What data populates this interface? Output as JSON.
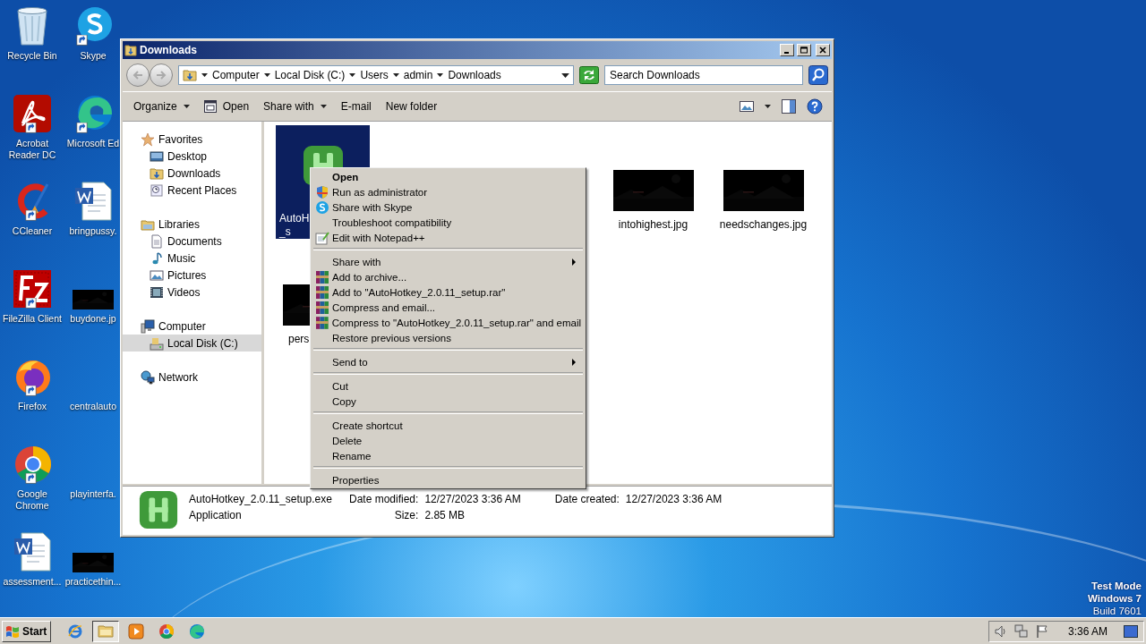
{
  "desktop": {
    "icons_column_1": [
      {
        "label": "Recycle Bin",
        "kind": "recycle",
        "shortcut": false
      },
      {
        "label": "Acrobat Reader DC",
        "kind": "acrobat",
        "shortcut": true
      },
      {
        "label": "CCleaner",
        "kind": "ccleaner",
        "shortcut": true
      },
      {
        "label": "FileZilla Client",
        "kind": "filezilla",
        "shortcut": true
      },
      {
        "label": "Firefox",
        "kind": "firefox",
        "shortcut": true
      },
      {
        "label": "Google Chrome",
        "kind": "chrome",
        "shortcut": true
      },
      {
        "label": "assessment...",
        "kind": "word",
        "shortcut": false
      }
    ],
    "icons_column_2": [
      {
        "label": "Skype",
        "kind": "skype",
        "shortcut": true
      },
      {
        "label": "Microsoft Ed",
        "kind": "edge",
        "shortcut": true
      },
      {
        "label": "bringpussy.",
        "kind": "word",
        "shortcut": false
      },
      {
        "label": "buydone.jp",
        "kind": "picture",
        "shortcut": false
      },
      {
        "label": "centralauto",
        "kind": "blank",
        "shortcut": false
      },
      {
        "label": "playinterfa.",
        "kind": "blank",
        "shortcut": false
      },
      {
        "label": "practicethin...",
        "kind": "picture",
        "shortcut": false
      }
    ]
  },
  "explorer": {
    "title": "Downloads",
    "breadcrumb": [
      "Computer",
      "Local Disk (C:)",
      "Users",
      "admin",
      "Downloads"
    ],
    "search": {
      "placeholder": "Search Downloads"
    },
    "toolbar": [
      {
        "label": "Organize",
        "dropdown": true,
        "kind": "plain"
      },
      {
        "label": "Open",
        "dropdown": false,
        "kind": "open"
      },
      {
        "label": "Share with",
        "dropdown": true,
        "kind": "plain"
      },
      {
        "label": "E-mail",
        "dropdown": false,
        "kind": "plain"
      },
      {
        "label": "New folder",
        "dropdown": false,
        "kind": "plain"
      }
    ],
    "navigation": [
      {
        "label": "Favorites",
        "kind": "star",
        "selected": false,
        "children": [
          {
            "label": "Desktop",
            "kind": "desktop",
            "selected": false
          },
          {
            "label": "Downloads",
            "kind": "downloads",
            "selected": false
          },
          {
            "label": "Recent Places",
            "kind": "recent",
            "selected": false
          }
        ]
      },
      {
        "label": "Libraries",
        "kind": "library",
        "selected": false,
        "children": [
          {
            "label": "Documents",
            "kind": "document",
            "selected": false
          },
          {
            "label": "Music",
            "kind": "music",
            "selected": false
          },
          {
            "label": "Pictures",
            "kind": "pictures",
            "selected": false
          },
          {
            "label": "Videos",
            "kind": "video",
            "selected": false
          }
        ]
      },
      {
        "label": "Computer",
        "kind": "computer",
        "selected": false,
        "children": [
          {
            "label": "Local Disk (C:)",
            "kind": "disk",
            "selected": true
          }
        ]
      },
      {
        "label": "Network",
        "kind": "network",
        "selected": false
      }
    ],
    "files": [
      {
        "label": [
          "AutoH",
          "_s"
        ],
        "kind": "app",
        "selected": true
      },
      {
        "label": [
          "intohighest.jpg"
        ],
        "kind": "picture",
        "selected": false
      },
      {
        "label": [
          "needschanges.jpg"
        ],
        "kind": "picture",
        "selected": false
      },
      {
        "label": [
          "pers"
        ],
        "kind": "picture",
        "selected": false
      }
    ],
    "details": {
      "name": "AutoHotkey_2.0.11_setup.exe",
      "type": "Application",
      "fields": [
        {
          "label": "Date modified:",
          "value": "12/27/2023 3:36 AM"
        },
        {
          "label": "Date created:",
          "value": "12/27/2023 3:36 AM"
        },
        {
          "label": "Size:",
          "value": "2.85 MB"
        }
      ]
    }
  },
  "context_menu": [
    [
      {
        "label": "Open",
        "default": true,
        "submenu": false,
        "kind": "plain"
      },
      {
        "label": "Run as administrator",
        "default": false,
        "submenu": false,
        "kind": "shield"
      },
      {
        "label": "Share with Skype",
        "default": false,
        "submenu": false,
        "kind": "skype"
      },
      {
        "label": "Troubleshoot compatibility",
        "default": false,
        "submenu": false,
        "kind": "plain"
      },
      {
        "label": "Edit with Notepad++",
        "default": false,
        "submenu": false,
        "kind": "notepad"
      }
    ],
    [
      {
        "label": "Share with",
        "default": false,
        "submenu": true,
        "kind": "plain"
      },
      {
        "label": "Add to archive...",
        "default": false,
        "submenu": false,
        "kind": "archive"
      },
      {
        "label": "Add to \"AutoHotkey_2.0.11_setup.rar\"",
        "default": false,
        "submenu": false,
        "kind": "archive"
      },
      {
        "label": "Compress and email...",
        "default": false,
        "submenu": false,
        "kind": "archive"
      },
      {
        "label": "Compress to \"AutoHotkey_2.0.11_setup.rar\" and email",
        "default": false,
        "submenu": false,
        "kind": "archive"
      },
      {
        "label": "Restore previous versions",
        "default": false,
        "submenu": false,
        "kind": "plain"
      }
    ],
    [
      {
        "label": "Send to",
        "default": false,
        "submenu": true,
        "kind": "plain"
      }
    ],
    [
      {
        "label": "Cut",
        "default": false,
        "submenu": false,
        "kind": "plain"
      },
      {
        "label": "Copy",
        "default": false,
        "submenu": false,
        "kind": "plain"
      }
    ],
    [
      {
        "label": "Create shortcut",
        "default": false,
        "submenu": false,
        "kind": "plain"
      },
      {
        "label": "Delete",
        "default": false,
        "submenu": false,
        "kind": "plain"
      },
      {
        "label": "Rename",
        "default": false,
        "submenu": false,
        "kind": "plain"
      }
    ],
    [
      {
        "label": "Properties",
        "default": false,
        "submenu": false,
        "kind": "plain"
      }
    ]
  ],
  "system_info": [
    "Test Mode",
    "Windows 7",
    "Build 7601"
  ],
  "taskbar": {
    "start": "Start",
    "apps": [
      {
        "kind": "ie",
        "selected": false
      },
      {
        "kind": "explorer",
        "selected": true
      },
      {
        "kind": "media",
        "selected": false
      },
      {
        "kind": "chrome",
        "selected": false
      },
      {
        "kind": "edge",
        "selected": false
      }
    ],
    "tray": [
      {
        "kind": "speaker"
      },
      {
        "kind": "network"
      },
      {
        "kind": "flag"
      }
    ],
    "clock": "3:36 AM"
  }
}
